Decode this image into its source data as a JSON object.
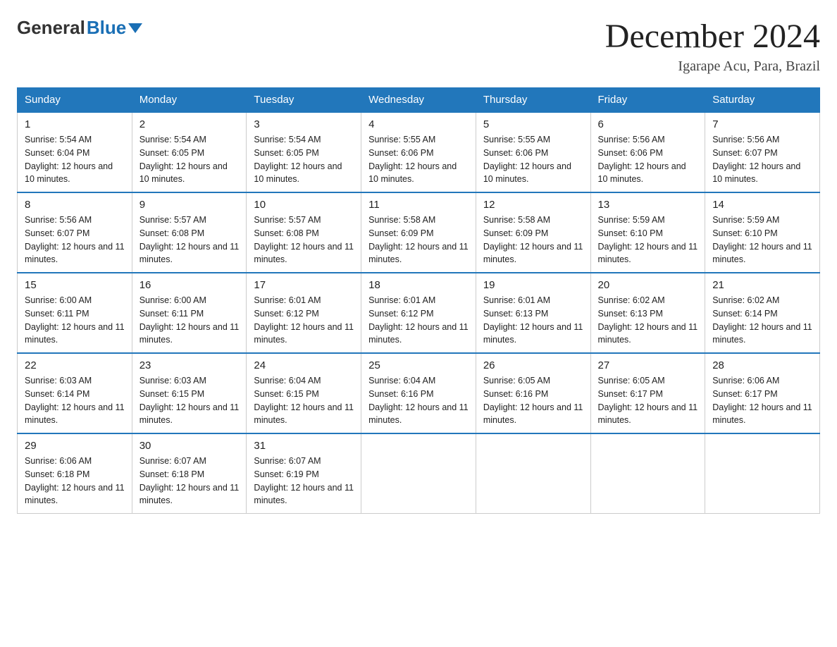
{
  "header": {
    "logo": {
      "general": "General",
      "blue": "Blue"
    },
    "title": "December 2024",
    "location": "Igarape Acu, Para, Brazil"
  },
  "days_of_week": [
    "Sunday",
    "Monday",
    "Tuesday",
    "Wednesday",
    "Thursday",
    "Friday",
    "Saturday"
  ],
  "weeks": [
    [
      {
        "day": "1",
        "sunrise": "5:54 AM",
        "sunset": "6:04 PM",
        "daylight": "12 hours and 10 minutes."
      },
      {
        "day": "2",
        "sunrise": "5:54 AM",
        "sunset": "6:05 PM",
        "daylight": "12 hours and 10 minutes."
      },
      {
        "day": "3",
        "sunrise": "5:54 AM",
        "sunset": "6:05 PM",
        "daylight": "12 hours and 10 minutes."
      },
      {
        "day": "4",
        "sunrise": "5:55 AM",
        "sunset": "6:06 PM",
        "daylight": "12 hours and 10 minutes."
      },
      {
        "day": "5",
        "sunrise": "5:55 AM",
        "sunset": "6:06 PM",
        "daylight": "12 hours and 10 minutes."
      },
      {
        "day": "6",
        "sunrise": "5:56 AM",
        "sunset": "6:06 PM",
        "daylight": "12 hours and 10 minutes."
      },
      {
        "day": "7",
        "sunrise": "5:56 AM",
        "sunset": "6:07 PM",
        "daylight": "12 hours and 10 minutes."
      }
    ],
    [
      {
        "day": "8",
        "sunrise": "5:56 AM",
        "sunset": "6:07 PM",
        "daylight": "12 hours and 11 minutes."
      },
      {
        "day": "9",
        "sunrise": "5:57 AM",
        "sunset": "6:08 PM",
        "daylight": "12 hours and 11 minutes."
      },
      {
        "day": "10",
        "sunrise": "5:57 AM",
        "sunset": "6:08 PM",
        "daylight": "12 hours and 11 minutes."
      },
      {
        "day": "11",
        "sunrise": "5:58 AM",
        "sunset": "6:09 PM",
        "daylight": "12 hours and 11 minutes."
      },
      {
        "day": "12",
        "sunrise": "5:58 AM",
        "sunset": "6:09 PM",
        "daylight": "12 hours and 11 minutes."
      },
      {
        "day": "13",
        "sunrise": "5:59 AM",
        "sunset": "6:10 PM",
        "daylight": "12 hours and 11 minutes."
      },
      {
        "day": "14",
        "sunrise": "5:59 AM",
        "sunset": "6:10 PM",
        "daylight": "12 hours and 11 minutes."
      }
    ],
    [
      {
        "day": "15",
        "sunrise": "6:00 AM",
        "sunset": "6:11 PM",
        "daylight": "12 hours and 11 minutes."
      },
      {
        "day": "16",
        "sunrise": "6:00 AM",
        "sunset": "6:11 PM",
        "daylight": "12 hours and 11 minutes."
      },
      {
        "day": "17",
        "sunrise": "6:01 AM",
        "sunset": "6:12 PM",
        "daylight": "12 hours and 11 minutes."
      },
      {
        "day": "18",
        "sunrise": "6:01 AM",
        "sunset": "6:12 PM",
        "daylight": "12 hours and 11 minutes."
      },
      {
        "day": "19",
        "sunrise": "6:01 AM",
        "sunset": "6:13 PM",
        "daylight": "12 hours and 11 minutes."
      },
      {
        "day": "20",
        "sunrise": "6:02 AM",
        "sunset": "6:13 PM",
        "daylight": "12 hours and 11 minutes."
      },
      {
        "day": "21",
        "sunrise": "6:02 AM",
        "sunset": "6:14 PM",
        "daylight": "12 hours and 11 minutes."
      }
    ],
    [
      {
        "day": "22",
        "sunrise": "6:03 AM",
        "sunset": "6:14 PM",
        "daylight": "12 hours and 11 minutes."
      },
      {
        "day": "23",
        "sunrise": "6:03 AM",
        "sunset": "6:15 PM",
        "daylight": "12 hours and 11 minutes."
      },
      {
        "day": "24",
        "sunrise": "6:04 AM",
        "sunset": "6:15 PM",
        "daylight": "12 hours and 11 minutes."
      },
      {
        "day": "25",
        "sunrise": "6:04 AM",
        "sunset": "6:16 PM",
        "daylight": "12 hours and 11 minutes."
      },
      {
        "day": "26",
        "sunrise": "6:05 AM",
        "sunset": "6:16 PM",
        "daylight": "12 hours and 11 minutes."
      },
      {
        "day": "27",
        "sunrise": "6:05 AM",
        "sunset": "6:17 PM",
        "daylight": "12 hours and 11 minutes."
      },
      {
        "day": "28",
        "sunrise": "6:06 AM",
        "sunset": "6:17 PM",
        "daylight": "12 hours and 11 minutes."
      }
    ],
    [
      {
        "day": "29",
        "sunrise": "6:06 AM",
        "sunset": "6:18 PM",
        "daylight": "12 hours and 11 minutes."
      },
      {
        "day": "30",
        "sunrise": "6:07 AM",
        "sunset": "6:18 PM",
        "daylight": "12 hours and 11 minutes."
      },
      {
        "day": "31",
        "sunrise": "6:07 AM",
        "sunset": "6:19 PM",
        "daylight": "12 hours and 11 minutes."
      },
      null,
      null,
      null,
      null
    ]
  ]
}
